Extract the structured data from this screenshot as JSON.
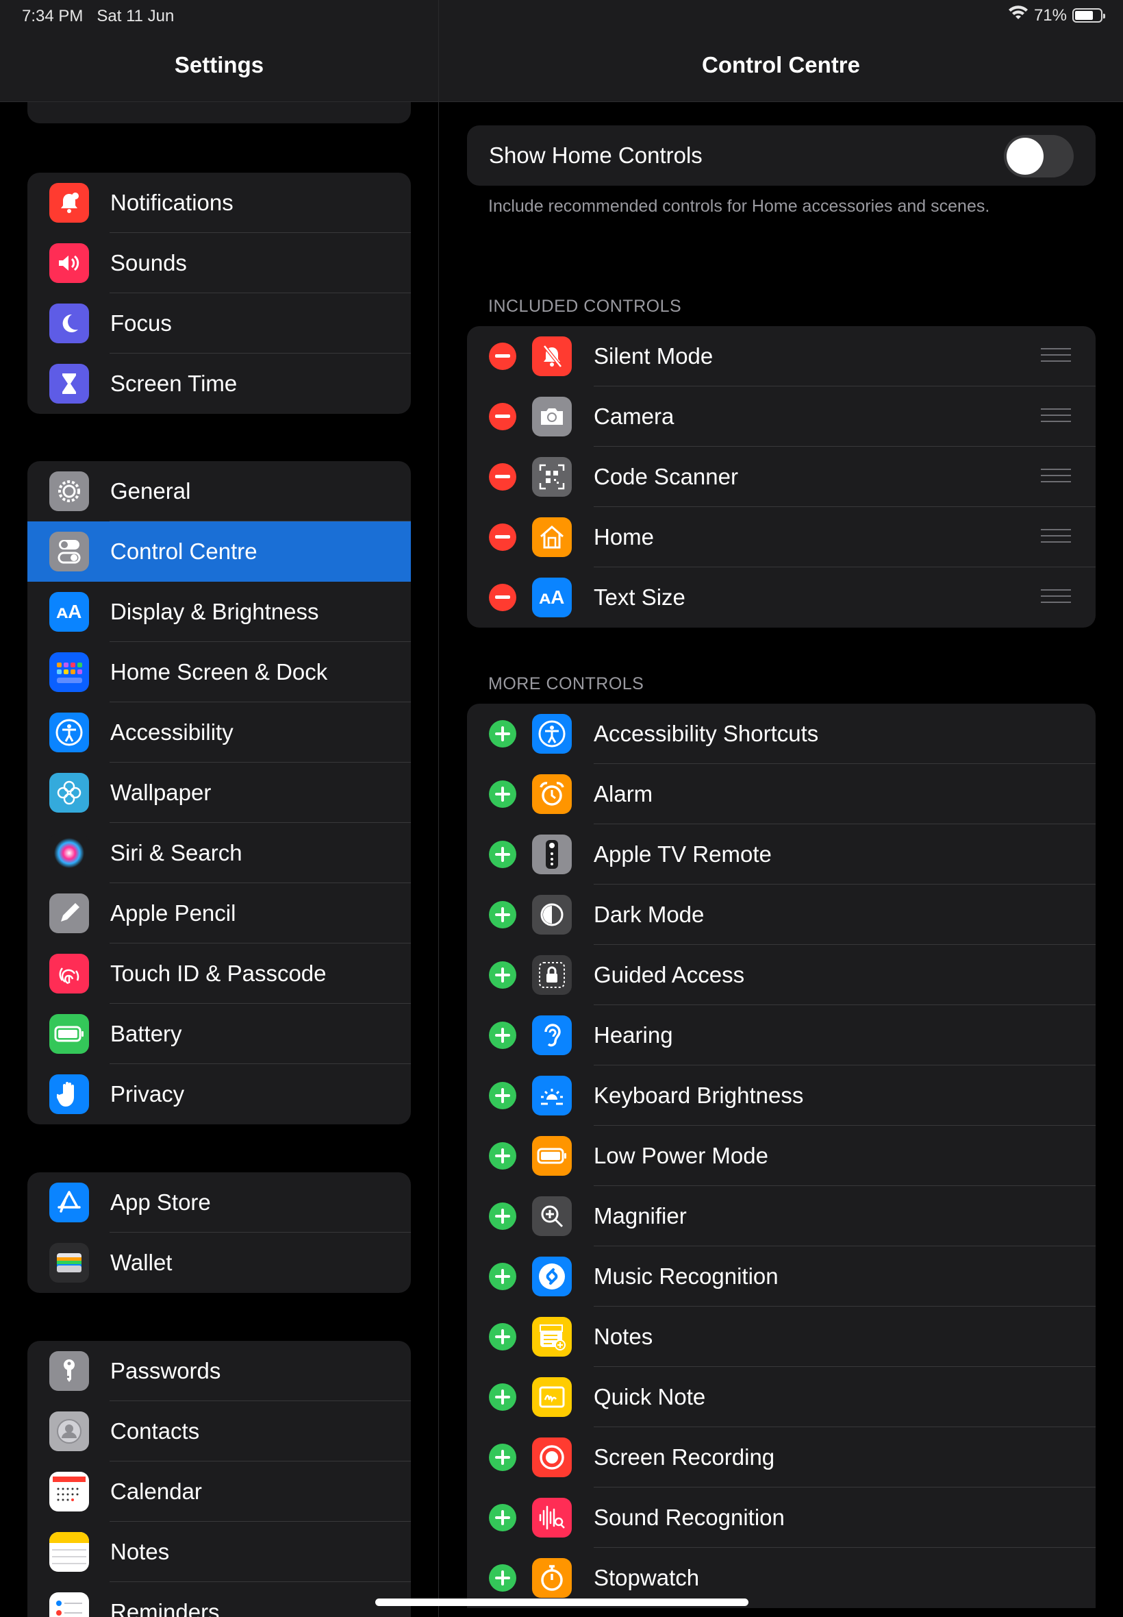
{
  "status_bar": {
    "time": "7:34 PM   Sat 11 Jun",
    "battery": "71%",
    "battery_level": 0.71
  },
  "left": {
    "title": "Settings",
    "groups": [
      [
        {
          "label": "Notifications",
          "icon": "bell-badge-icon",
          "color": "#ff3b30"
        },
        {
          "label": "Sounds",
          "icon": "speaker-icon",
          "color": "#ff2d55"
        },
        {
          "label": "Focus",
          "icon": "moon-icon",
          "color": "#5e5ce6"
        },
        {
          "label": "Screen Time",
          "icon": "hourglass-icon",
          "color": "#5e5ce6"
        }
      ],
      [
        {
          "label": "General",
          "icon": "gear-icon",
          "color": "#8e8e93"
        },
        {
          "label": "Control Centre",
          "icon": "toggles-icon",
          "color": "#8e8e93",
          "selected": true
        },
        {
          "label": "Display & Brightness",
          "icon": "text-size-icon",
          "color": "#0a84ff"
        },
        {
          "label": "Home Screen & Dock",
          "icon": "app-grid-icon",
          "color": "#0a60ff"
        },
        {
          "label": "Accessibility",
          "icon": "accessibility-icon",
          "color": "#0a84ff"
        },
        {
          "label": "Wallpaper",
          "icon": "flower-icon",
          "color": "#34aadc"
        },
        {
          "label": "Siri & Search",
          "icon": "siri-icon",
          "color": "#1c1c1e"
        },
        {
          "label": "Apple Pencil",
          "icon": "pencil-icon",
          "color": "#8e8e93"
        },
        {
          "label": "Touch ID & Passcode",
          "icon": "fingerprint-icon",
          "color": "#ff2d55"
        },
        {
          "label": "Battery",
          "icon": "battery-icon",
          "color": "#34c759"
        },
        {
          "label": "Privacy",
          "icon": "hand-icon",
          "color": "#0a84ff"
        }
      ],
      [
        {
          "label": "App Store",
          "icon": "app-store-icon",
          "color": "#0a84ff"
        },
        {
          "label": "Wallet",
          "icon": "wallet-icon",
          "color": "#2c2c2e"
        }
      ],
      [
        {
          "label": "Passwords",
          "icon": "key-icon",
          "color": "#8e8e93"
        },
        {
          "label": "Contacts",
          "icon": "contacts-icon",
          "color": "#aeaeb2"
        },
        {
          "label": "Calendar",
          "icon": "calendar-icon",
          "color": "#ffffff"
        },
        {
          "label": "Notes",
          "icon": "notes-icon",
          "color": "#ffffff"
        },
        {
          "label": "Reminders",
          "icon": "reminders-icon",
          "color": "#ffffff"
        }
      ]
    ]
  },
  "right": {
    "title": "Control Centre",
    "home_controls": {
      "label": "Show Home Controls",
      "on": false,
      "footnote": "Include recommended controls for Home accessories and scenes."
    },
    "included_header": "INCLUDED CONTROLS",
    "included": [
      {
        "label": "Silent Mode",
        "icon": "bell-slash-icon",
        "color": "#ff3b30"
      },
      {
        "label": "Camera",
        "icon": "camera-icon",
        "color": "#8e8e93"
      },
      {
        "label": "Code Scanner",
        "icon": "qr-code-icon",
        "color": "#636366"
      },
      {
        "label": "Home",
        "icon": "house-icon",
        "color": "#ff9500"
      },
      {
        "label": "Text Size",
        "icon": "text-size-icon",
        "color": "#0a84ff"
      }
    ],
    "more_header": "MORE CONTROLS",
    "more": [
      {
        "label": "Accessibility Shortcuts",
        "icon": "accessibility-icon",
        "color": "#0a84ff"
      },
      {
        "label": "Alarm",
        "icon": "alarm-clock-icon",
        "color": "#ff9500"
      },
      {
        "label": "Apple TV Remote",
        "icon": "remote-icon",
        "color": "#8e8e93"
      },
      {
        "label": "Dark Mode",
        "icon": "dark-mode-icon",
        "color": "#48484a"
      },
      {
        "label": "Guided Access",
        "icon": "lock-icon",
        "color": "#3a3a3c"
      },
      {
        "label": "Hearing",
        "icon": "ear-icon",
        "color": "#0a84ff"
      },
      {
        "label": "Keyboard Brightness",
        "icon": "keyboard-brightness-icon",
        "color": "#0a84ff"
      },
      {
        "label": "Low Power Mode",
        "icon": "battery-icon",
        "color": "#ff9500"
      },
      {
        "label": "Magnifier",
        "icon": "magnifier-icon",
        "color": "#48484a"
      },
      {
        "label": "Music Recognition",
        "icon": "shazam-icon",
        "color": "#0a84ff"
      },
      {
        "label": "Notes",
        "icon": "note-add-icon",
        "color": "#ffcc00"
      },
      {
        "label": "Quick Note",
        "icon": "quick-note-icon",
        "color": "#ffcc00"
      },
      {
        "label": "Screen Recording",
        "icon": "record-icon",
        "color": "#ff3b30"
      },
      {
        "label": "Sound Recognition",
        "icon": "waveform-icon",
        "color": "#ff2d55"
      },
      {
        "label": "Stopwatch",
        "icon": "stopwatch-icon",
        "color": "#ff9500"
      }
    ]
  }
}
